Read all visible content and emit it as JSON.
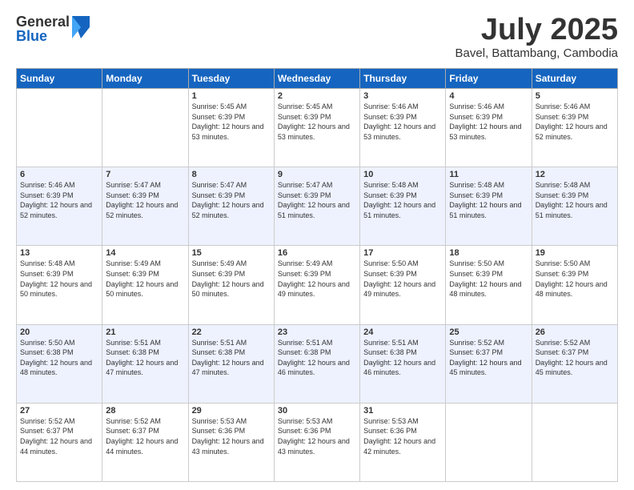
{
  "logo": {
    "general": "General",
    "blue": "Blue"
  },
  "header": {
    "month": "July 2025",
    "location": "Bavel, Battambang, Cambodia"
  },
  "weekdays": [
    "Sunday",
    "Monday",
    "Tuesday",
    "Wednesday",
    "Thursday",
    "Friday",
    "Saturday"
  ],
  "weeks": [
    [
      {
        "day": "",
        "sunrise": "",
        "sunset": "",
        "daylight": ""
      },
      {
        "day": "",
        "sunrise": "",
        "sunset": "",
        "daylight": ""
      },
      {
        "day": "1",
        "sunrise": "Sunrise: 5:45 AM",
        "sunset": "Sunset: 6:39 PM",
        "daylight": "Daylight: 12 hours and 53 minutes."
      },
      {
        "day": "2",
        "sunrise": "Sunrise: 5:45 AM",
        "sunset": "Sunset: 6:39 PM",
        "daylight": "Daylight: 12 hours and 53 minutes."
      },
      {
        "day": "3",
        "sunrise": "Sunrise: 5:46 AM",
        "sunset": "Sunset: 6:39 PM",
        "daylight": "Daylight: 12 hours and 53 minutes."
      },
      {
        "day": "4",
        "sunrise": "Sunrise: 5:46 AM",
        "sunset": "Sunset: 6:39 PM",
        "daylight": "Daylight: 12 hours and 53 minutes."
      },
      {
        "day": "5",
        "sunrise": "Sunrise: 5:46 AM",
        "sunset": "Sunset: 6:39 PM",
        "daylight": "Daylight: 12 hours and 52 minutes."
      }
    ],
    [
      {
        "day": "6",
        "sunrise": "Sunrise: 5:46 AM",
        "sunset": "Sunset: 6:39 PM",
        "daylight": "Daylight: 12 hours and 52 minutes."
      },
      {
        "day": "7",
        "sunrise": "Sunrise: 5:47 AM",
        "sunset": "Sunset: 6:39 PM",
        "daylight": "Daylight: 12 hours and 52 minutes."
      },
      {
        "day": "8",
        "sunrise": "Sunrise: 5:47 AM",
        "sunset": "Sunset: 6:39 PM",
        "daylight": "Daylight: 12 hours and 52 minutes."
      },
      {
        "day": "9",
        "sunrise": "Sunrise: 5:47 AM",
        "sunset": "Sunset: 6:39 PM",
        "daylight": "Daylight: 12 hours and 51 minutes."
      },
      {
        "day": "10",
        "sunrise": "Sunrise: 5:48 AM",
        "sunset": "Sunset: 6:39 PM",
        "daylight": "Daylight: 12 hours and 51 minutes."
      },
      {
        "day": "11",
        "sunrise": "Sunrise: 5:48 AM",
        "sunset": "Sunset: 6:39 PM",
        "daylight": "Daylight: 12 hours and 51 minutes."
      },
      {
        "day": "12",
        "sunrise": "Sunrise: 5:48 AM",
        "sunset": "Sunset: 6:39 PM",
        "daylight": "Daylight: 12 hours and 51 minutes."
      }
    ],
    [
      {
        "day": "13",
        "sunrise": "Sunrise: 5:48 AM",
        "sunset": "Sunset: 6:39 PM",
        "daylight": "Daylight: 12 hours and 50 minutes."
      },
      {
        "day": "14",
        "sunrise": "Sunrise: 5:49 AM",
        "sunset": "Sunset: 6:39 PM",
        "daylight": "Daylight: 12 hours and 50 minutes."
      },
      {
        "day": "15",
        "sunrise": "Sunrise: 5:49 AM",
        "sunset": "Sunset: 6:39 PM",
        "daylight": "Daylight: 12 hours and 50 minutes."
      },
      {
        "day": "16",
        "sunrise": "Sunrise: 5:49 AM",
        "sunset": "Sunset: 6:39 PM",
        "daylight": "Daylight: 12 hours and 49 minutes."
      },
      {
        "day": "17",
        "sunrise": "Sunrise: 5:50 AM",
        "sunset": "Sunset: 6:39 PM",
        "daylight": "Daylight: 12 hours and 49 minutes."
      },
      {
        "day": "18",
        "sunrise": "Sunrise: 5:50 AM",
        "sunset": "Sunset: 6:39 PM",
        "daylight": "Daylight: 12 hours and 48 minutes."
      },
      {
        "day": "19",
        "sunrise": "Sunrise: 5:50 AM",
        "sunset": "Sunset: 6:39 PM",
        "daylight": "Daylight: 12 hours and 48 minutes."
      }
    ],
    [
      {
        "day": "20",
        "sunrise": "Sunrise: 5:50 AM",
        "sunset": "Sunset: 6:38 PM",
        "daylight": "Daylight: 12 hours and 48 minutes."
      },
      {
        "day": "21",
        "sunrise": "Sunrise: 5:51 AM",
        "sunset": "Sunset: 6:38 PM",
        "daylight": "Daylight: 12 hours and 47 minutes."
      },
      {
        "day": "22",
        "sunrise": "Sunrise: 5:51 AM",
        "sunset": "Sunset: 6:38 PM",
        "daylight": "Daylight: 12 hours and 47 minutes."
      },
      {
        "day": "23",
        "sunrise": "Sunrise: 5:51 AM",
        "sunset": "Sunset: 6:38 PM",
        "daylight": "Daylight: 12 hours and 46 minutes."
      },
      {
        "day": "24",
        "sunrise": "Sunrise: 5:51 AM",
        "sunset": "Sunset: 6:38 PM",
        "daylight": "Daylight: 12 hours and 46 minutes."
      },
      {
        "day": "25",
        "sunrise": "Sunrise: 5:52 AM",
        "sunset": "Sunset: 6:37 PM",
        "daylight": "Daylight: 12 hours and 45 minutes."
      },
      {
        "day": "26",
        "sunrise": "Sunrise: 5:52 AM",
        "sunset": "Sunset: 6:37 PM",
        "daylight": "Daylight: 12 hours and 45 minutes."
      }
    ],
    [
      {
        "day": "27",
        "sunrise": "Sunrise: 5:52 AM",
        "sunset": "Sunset: 6:37 PM",
        "daylight": "Daylight: 12 hours and 44 minutes."
      },
      {
        "day": "28",
        "sunrise": "Sunrise: 5:52 AM",
        "sunset": "Sunset: 6:37 PM",
        "daylight": "Daylight: 12 hours and 44 minutes."
      },
      {
        "day": "29",
        "sunrise": "Sunrise: 5:53 AM",
        "sunset": "Sunset: 6:36 PM",
        "daylight": "Daylight: 12 hours and 43 minutes."
      },
      {
        "day": "30",
        "sunrise": "Sunrise: 5:53 AM",
        "sunset": "Sunset: 6:36 PM",
        "daylight": "Daylight: 12 hours and 43 minutes."
      },
      {
        "day": "31",
        "sunrise": "Sunrise: 5:53 AM",
        "sunset": "Sunset: 6:36 PM",
        "daylight": "Daylight: 12 hours and 42 minutes."
      },
      {
        "day": "",
        "sunrise": "",
        "sunset": "",
        "daylight": ""
      },
      {
        "day": "",
        "sunrise": "",
        "sunset": "",
        "daylight": ""
      }
    ]
  ]
}
